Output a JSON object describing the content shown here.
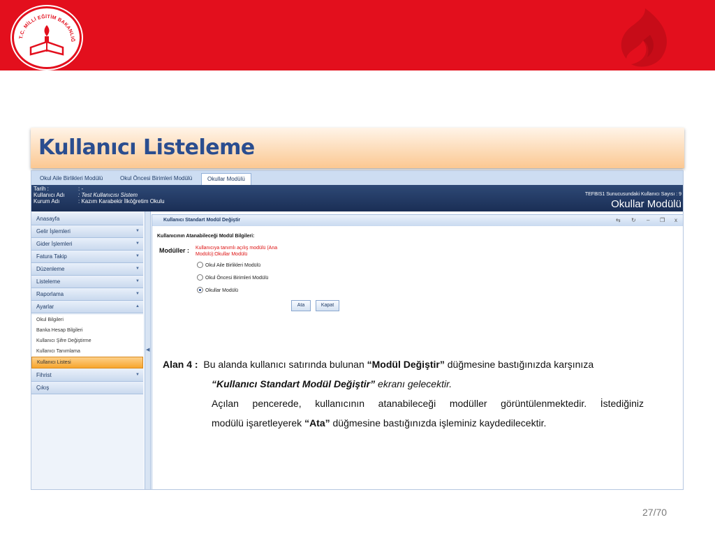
{
  "header": {
    "logo_text": "T.C. MİLLİ EĞİTİM BAKANLIĞI",
    "colors": {
      "band": "#e30f1d",
      "title": "#2a4d8f",
      "highlight": "#f7a62d"
    }
  },
  "slide": {
    "title": "Kullanıcı Listeleme",
    "page": "27/70"
  },
  "app": {
    "tabs": [
      {
        "label": "Okul Aile Birlikleri Modülü",
        "active": false
      },
      {
        "label": "Okul Öncesi Birimleri Modülü",
        "active": false
      },
      {
        "label": "Okullar Modülü",
        "active": true
      }
    ],
    "info": {
      "date_key": "Tarih :",
      "date_value": ": -",
      "user_key": "Kullanıcı Adı",
      "user_value": ": Test Kullanıcısı Sistem",
      "school_key": "Kurum Adı",
      "school_value": ": Kazım Karabekir İlköğretim Okulu",
      "server_info": "TEFBIS1 Sunucusundaki Kullanıcı Sayısı : 9",
      "module_name": "Okullar Modülü"
    },
    "sidebar": {
      "menu": [
        {
          "label": "Anasayfa",
          "arrow": ""
        },
        {
          "label": "Gelir İşlemleri",
          "arrow": "▼"
        },
        {
          "label": "Gider İşlemleri",
          "arrow": "▼"
        },
        {
          "label": "Fatura Takip",
          "arrow": "▼"
        },
        {
          "label": "Düzenleme",
          "arrow": "▼"
        },
        {
          "label": "Listeleme",
          "arrow": "▼"
        },
        {
          "label": "Raporlama",
          "arrow": "▼"
        },
        {
          "label": "Ayarlar",
          "arrow": "▲"
        }
      ],
      "submenu": [
        {
          "label": "Okul Bilgileri"
        },
        {
          "label": "Banka Hesap Bilgileri"
        },
        {
          "label": "Kullanıcı Şifre Değiştirme"
        },
        {
          "label": "Kullanıcı Tanımlama"
        },
        {
          "label": "Kullanıcı Listesi",
          "selected": true
        }
      ],
      "bottom_menu": [
        {
          "label": "Fihrist",
          "arrow": "▼"
        },
        {
          "label": "Çıkış",
          "arrow": ""
        }
      ]
    },
    "panel": {
      "title": "Kullanıcı Standart Modül Değiştir",
      "tools": [
        "⇆",
        "↻",
        "–",
        "❐",
        "x"
      ],
      "section_title": "Kullanıcının Atanabileceği Modül Bilgileri:",
      "modules_label": "Modüller :",
      "note": "Kullanıcıya tanımlı açılış modülü (Ana Modülü):Okullar Modülü",
      "options": [
        {
          "label": "Okul Aile Birlikleri Modülü",
          "checked": false
        },
        {
          "label": "Okul Öncesi Birimleri Modülü",
          "checked": false
        },
        {
          "label": "Okullar Modülü",
          "checked": true
        }
      ],
      "buttons": {
        "assign": "Ata",
        "close": "Kapat"
      }
    }
  },
  "annotation": {
    "label": "Alan 4 :",
    "line1_pre": "Bu alanda kullanıcı satırında bulunan",
    "line1_bold": "“Modül Değiştir”",
    "line1_post": "düğmesine bastığınızda karşınıza",
    "line2_boldit": "“Kullanıcı Standart Modül Değiştir”",
    "line2_it": "ekranı gelecektir.",
    "line3": "Açılan pencerede, kullanıcının atanabileceği modüller görüntülenmektedir. İstediğiniz",
    "line4_pre": "modülü işaretleyerek",
    "line4_bold": "“Ata”",
    "line4_post": "düğmesine bastığınızda işleminiz kaydedilecektir."
  }
}
